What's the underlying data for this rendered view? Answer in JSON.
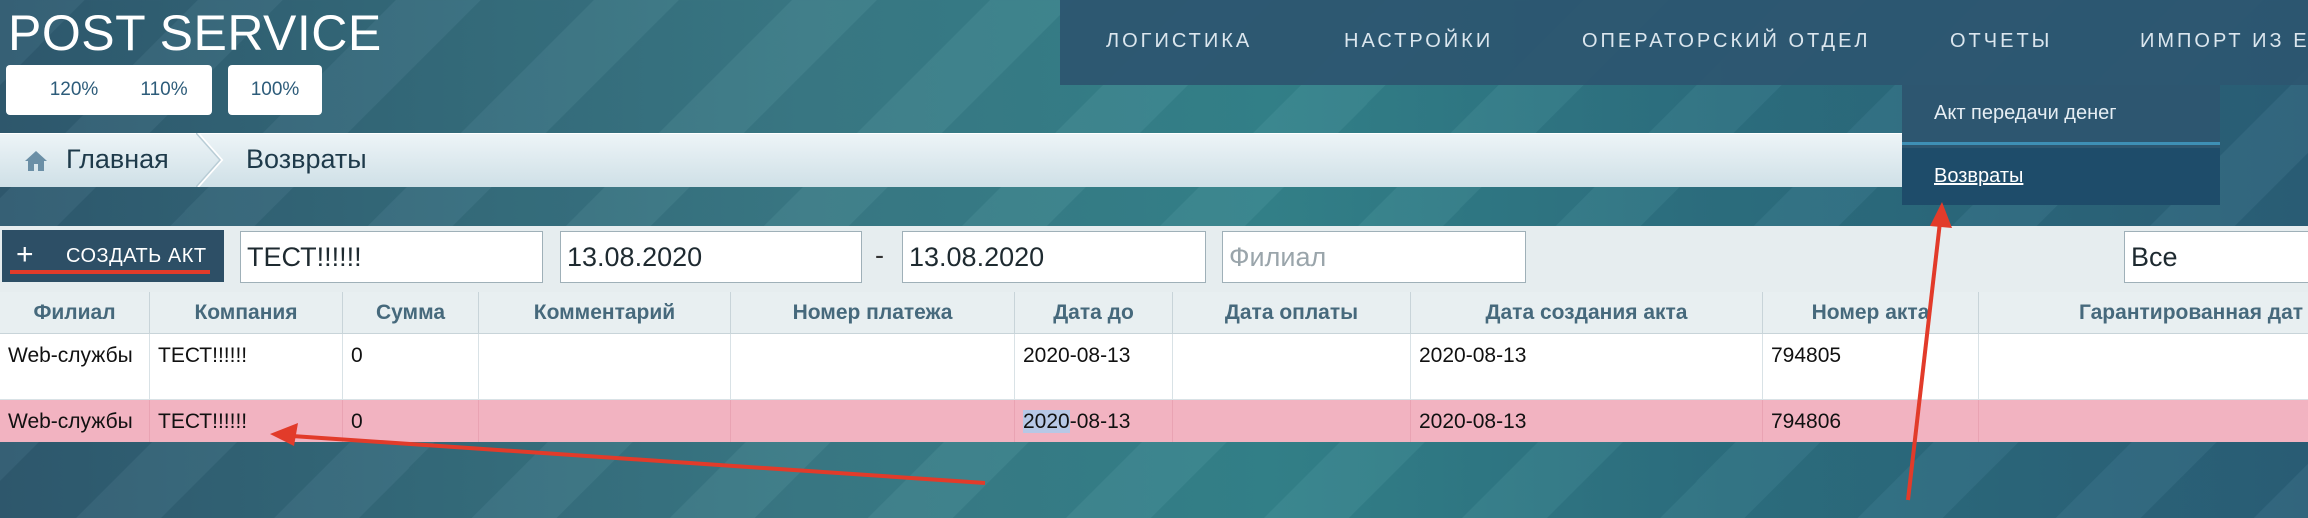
{
  "brand": {
    "title": "POST SERVICE"
  },
  "zoom": [
    "120%",
    "110%",
    "100%"
  ],
  "nav": [
    "ЛОГИСТИКА",
    "НАСТРОЙКИ",
    "ОПЕРАТОРСКИЙ ОТДЕЛ",
    "ОТЧЕТЫ",
    "ИМПОРТ ИЗ EX"
  ],
  "dropdown": [
    "Акт передачи денег",
    "Возвраты"
  ],
  "breadcrumb": {
    "home": "Главная",
    "current": "Возвраты"
  },
  "toolbar": {
    "create_label": "СОЗДАТЬ АКТ",
    "company_value": "ТЕСТ!!!!!!",
    "date_from": "13.08.2020",
    "date_sep": "-",
    "date_to": "13.08.2020",
    "branch_placeholder": "Филиал",
    "filter_value": "Все"
  },
  "table": {
    "headers": [
      "Филиал",
      "Компания",
      "Сумма",
      "Комментарий",
      "Номер платежа",
      "Дата до",
      "Дата оплаты",
      "Дата создания акта",
      "Номер акта",
      "Гарантированная дат"
    ],
    "rows": [
      [
        "Web-службы",
        "ТЕСТ!!!!!!",
        "0",
        "",
        "",
        "2020-08-13",
        "",
        "2020-08-13",
        "794805",
        ""
      ],
      [
        "Web-службы",
        "ТЕСТ!!!!!!",
        "0",
        "",
        "",
        "-08-13",
        "",
        "2020-08-13",
        "794806",
        ""
      ]
    ],
    "selected_text": "2020"
  },
  "colors": {
    "accent_red": "#e23b2a",
    "nav_bg": "#2d5670",
    "highlight_row": "#f2b3c1"
  },
  "icons": {
    "home": "home-icon",
    "plus": "plus-icon"
  }
}
